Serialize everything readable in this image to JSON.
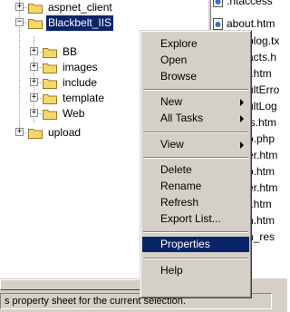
{
  "tree": {
    "items": [
      {
        "label": "aspnet_client",
        "expander": "+"
      },
      {
        "label": "Blackbelt_IIS",
        "expander": "−"
      },
      {
        "label": "BB",
        "expander": "+"
      },
      {
        "label": "images",
        "expander": "+"
      },
      {
        "label": "include",
        "expander": "+"
      },
      {
        "label": "template",
        "expander": "+"
      },
      {
        "label": "Web",
        "expander": "+"
      },
      {
        "label": "upload",
        "expander": "+"
      }
    ]
  },
  "files": [
    ".htaccess",
    "about.htm",
    "blog.tx",
    "acts.h",
    "t.htm",
    "ultErro",
    "ultLog",
    "ls.htm",
    "o.php",
    "er.htm",
    "p.htm",
    "er.htm",
    "t.htm",
    "h.htm",
    "h_res"
  ],
  "menu": {
    "explore": "Explore",
    "open": "Open",
    "browse": "Browse",
    "new": "New",
    "all_tasks": "All Tasks",
    "view": "View",
    "delete": "Delete",
    "rename": "Rename",
    "refresh": "Refresh",
    "export_list": "Export List...",
    "properties": "Properties",
    "help": "Help"
  },
  "status": {
    "text": "s property sheet for the current selection."
  },
  "colors": {
    "selection": "#0a246a",
    "folder": "#f5d76a",
    "chrome": "#d4d0c8"
  },
  "icons": {
    "folder": "folder-icon",
    "file": "web-file-icon",
    "submenu": "submenu-arrow-icon"
  }
}
